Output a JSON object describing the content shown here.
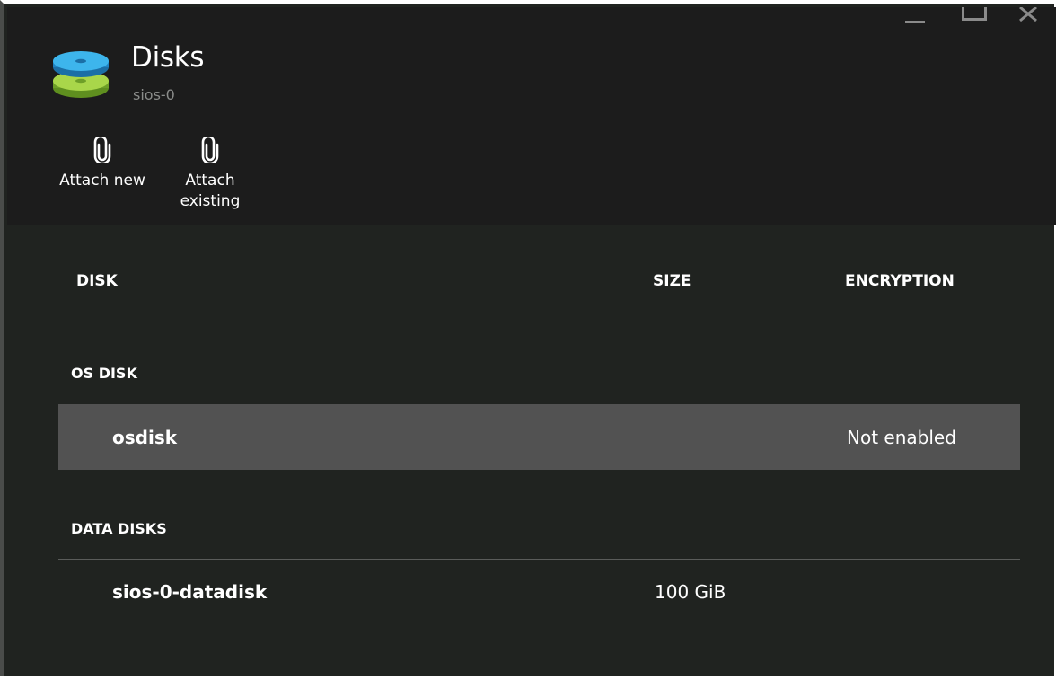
{
  "window": {
    "controls": [
      "minimize",
      "maximize",
      "close"
    ]
  },
  "header": {
    "icon": "disks-icon",
    "title": "Disks",
    "subtitle": "sios-0"
  },
  "commands": [
    {
      "label_line1": "Attach new",
      "label_line2": "",
      "icon": "paperclip-icon"
    },
    {
      "label_line1": "Attach",
      "label_line2": "existing",
      "icon": "paperclip-icon"
    }
  ],
  "table": {
    "columns": [
      "DISK",
      "SIZE",
      "ENCRYPTION"
    ],
    "sections": [
      {
        "label": "OS DISK",
        "rows": [
          {
            "disk": "osdisk",
            "size": "",
            "encryption": "Not enabled",
            "selected": true
          }
        ]
      },
      {
        "label": "DATA DISKS",
        "rows": [
          {
            "disk": "sios-0-datadisk",
            "size": "100 GiB",
            "encryption": "",
            "selected": false
          }
        ]
      }
    ]
  },
  "colors": {
    "blade_bg": "#202320",
    "header_bg": "#1c1c1c",
    "selected_row_bg": "#525252",
    "subtitle_text": "#8a8c8a",
    "disk_icon_blue": "#2fa8e0",
    "disk_icon_green": "#8dc63f"
  }
}
